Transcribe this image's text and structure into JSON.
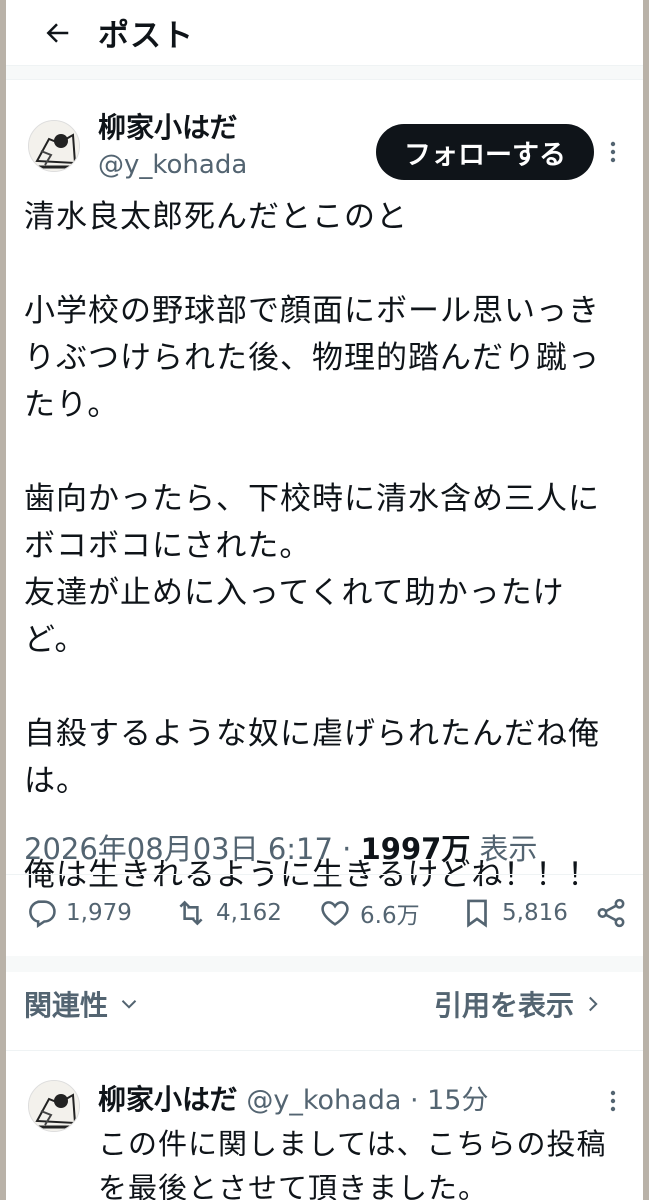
{
  "header": {
    "title": "ポスト",
    "back_icon": "arrow-left-icon"
  },
  "post": {
    "author_name": "柳家小はだ",
    "author_handle": "@y_kohada",
    "follow_label": "フォローする",
    "body": "清水良太郎死んだとこのと\n\n小学校の野球部で顔面にボール思いっきりぶつけられた後、物理的踏んだり蹴ったり。\n\n歯向かったら、下校時に清水含め三人にボコボコにされた。\n友達が止めに入ってくれて助かったけど。\n\n自殺するような奴に虐げられたんだね俺は。\n\n俺は生きれるように生きるけどね！！！",
    "timestamp": "2026年08月03日 6:17",
    "separator": " · ",
    "views_count": "1997万",
    "views_label": " 表示"
  },
  "actions": {
    "reply_count": "1,979",
    "retweet_count": "4,162",
    "like_count": "6.6万",
    "bookmark_count": "5,816"
  },
  "related": {
    "label": "関連性",
    "quotes_label": "引用を表示"
  },
  "reply": {
    "name": "柳家小はだ",
    "handle": "@y_kohada",
    "separator": " · ",
    "time": "15分",
    "text": "この件に関しましては、こちらの投稿を最後とさせて頂きました。"
  },
  "colors": {
    "text": "#0f1419",
    "secondary": "#536471",
    "button_bg": "#0f1419"
  }
}
